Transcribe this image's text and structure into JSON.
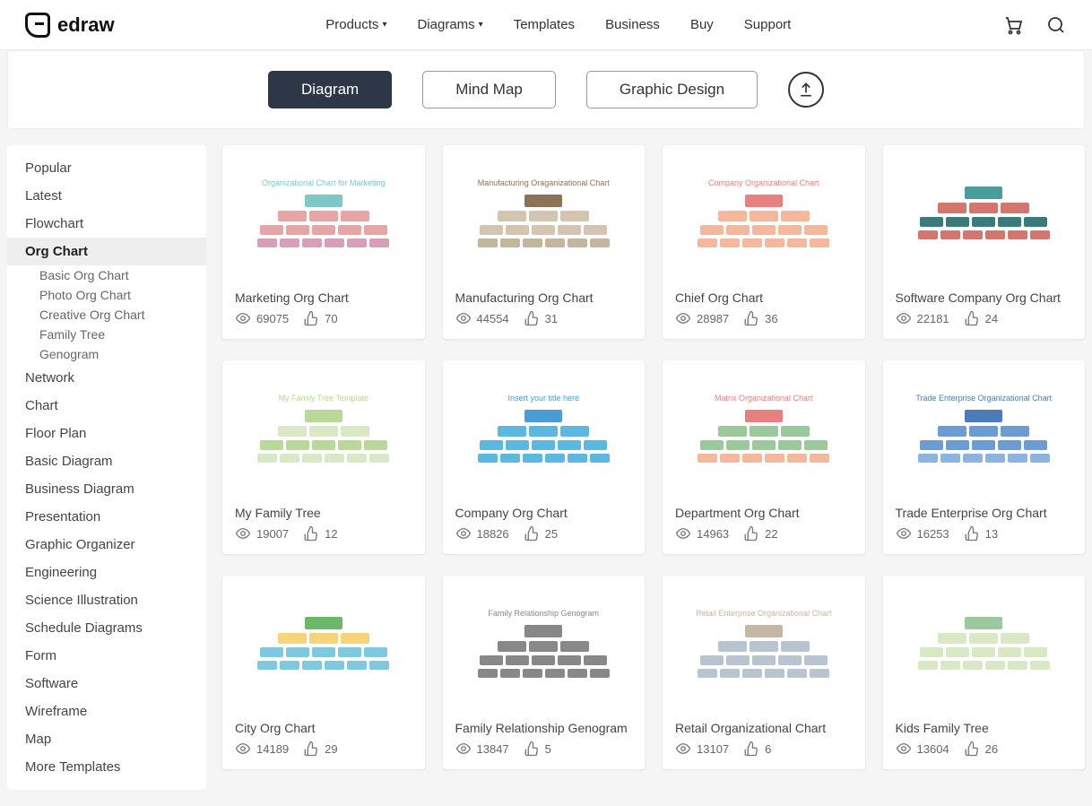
{
  "brand": "edraw",
  "nav": {
    "products": "Products",
    "diagrams": "Diagrams",
    "templates": "Templates",
    "business": "Business",
    "buy": "Buy",
    "support": "Support"
  },
  "tabs": {
    "diagram": "Diagram",
    "mindmap": "Mind Map",
    "graphic": "Graphic Design"
  },
  "sidebar": {
    "items": [
      "Popular",
      "Latest",
      "Flowchart",
      "Org Chart",
      "Network",
      "Chart",
      "Floor Plan",
      "Basic Diagram",
      "Business Diagram",
      "Presentation",
      "Graphic Organizer",
      "Engineering",
      "Science Illustration",
      "Schedule Diagrams",
      "Form",
      "Software",
      "Wireframe",
      "Map",
      "More Templates"
    ],
    "active": "Org Chart",
    "subitems": [
      "Basic Org Chart",
      "Photo Org Chart",
      "Creative Org Chart",
      "Family Tree",
      "Genogram"
    ]
  },
  "templates": [
    {
      "title": "Marketing Org Chart",
      "views": "69075",
      "likes": "70",
      "thumb_label": "Organizational Chart for Marketing",
      "palette": [
        "#7ec8c8",
        "#e8a5a5",
        "#e8a5a5",
        "#d89fb8"
      ]
    },
    {
      "title": "Manufacturing Org Chart",
      "views": "44554",
      "likes": "31",
      "thumb_label": "Manufacturing Oraganizational Chart",
      "palette": [
        "#8b7355",
        "#d4c5b0",
        "#d4c5b0",
        "#c4b59f"
      ]
    },
    {
      "title": "Chief Org Chart",
      "views": "28987",
      "likes": "36",
      "thumb_label": "Company Organizational Chart",
      "palette": [
        "#e88080",
        "#f5b89c",
        "#f5b89c",
        "#f5b89c"
      ]
    },
    {
      "title": "Software Company Org Chart",
      "views": "22181",
      "likes": "24",
      "thumb_label": "",
      "palette": [
        "#4a9d9d",
        "#d4756e",
        "#3a7a7a",
        "#d4756e"
      ]
    },
    {
      "title": "My Family Tree",
      "views": "19007",
      "likes": "12",
      "thumb_label": "My Family Tree Template",
      "palette": [
        "#b8d998",
        "#d9e8c5",
        "#b8d998",
        "#d9e8c5"
      ]
    },
    {
      "title": "Company Org Chart",
      "views": "18826",
      "likes": "25",
      "thumb_label": "Insert your title here",
      "palette": [
        "#4a9dd4",
        "#5bb8e0",
        "#5bb8e0",
        "#5bb8e0"
      ]
    },
    {
      "title": "Department Org Chart",
      "views": "14963",
      "likes": "22",
      "thumb_label": "Matrix Organizational Chart",
      "palette": [
        "#e88080",
        "#9cc99c",
        "#9cc99c",
        "#f5b89c"
      ]
    },
    {
      "title": "Trade Enterprise Org Chart",
      "views": "16253",
      "likes": "13",
      "thumb_label": "Trade Enterprise Organizational Chart",
      "palette": [
        "#4a7db8",
        "#6b9dd4",
        "#6b9dd4",
        "#8bb5e0"
      ]
    },
    {
      "title": "City Org Chart",
      "views": "14189",
      "likes": "29",
      "thumb_label": "",
      "palette": [
        "#6bb86b",
        "#f5d47a",
        "#7ec8e0",
        "#7ec8e0"
      ]
    },
    {
      "title": "Family Relationship Genogram",
      "views": "13847",
      "likes": "5",
      "thumb_label": "Family Relationship Genogram",
      "palette": [
        "#888",
        "#888",
        "#888",
        "#888"
      ]
    },
    {
      "title": "Retail Organizational Chart",
      "views": "13107",
      "likes": "6",
      "thumb_label": "Retail Enterprise Organizational Chart",
      "palette": [
        "#c4b8a5",
        "#b8c4d0",
        "#b8c4d0",
        "#b8c4d0"
      ]
    },
    {
      "title": "Kids Family Tree",
      "views": "13604",
      "likes": "26",
      "thumb_label": "",
      "palette": [
        "#9cc99c",
        "#d9e8c5",
        "#d9e8c5",
        "#d9e8c5"
      ]
    }
  ]
}
